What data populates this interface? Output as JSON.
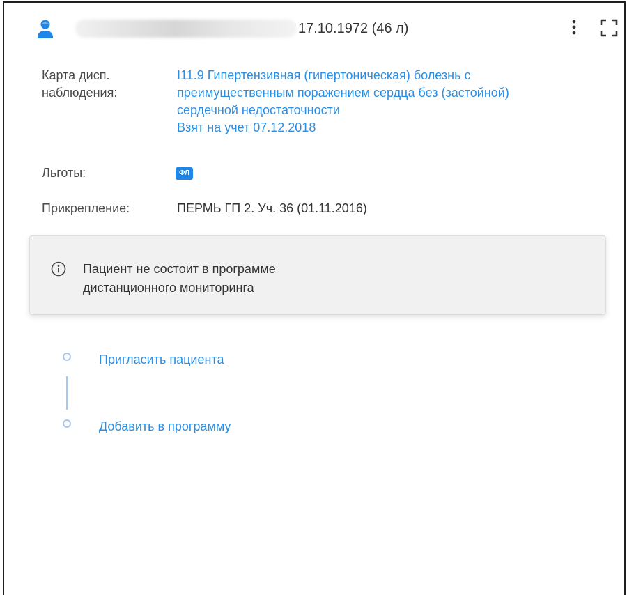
{
  "header": {
    "birth": "17.10.1972 (46 л)",
    "icons": {
      "avatar": "person-icon",
      "more": "more-vert-icon",
      "fullscreen": "fullscreen-icon"
    }
  },
  "disp": {
    "label_line1": "Карта дисп.",
    "label_line2": "наблюдения:",
    "diagnosis_line1": "I11.9 Гипертензивная (гипертоническая) болезнь с",
    "diagnosis_line2": "преимущественным поражением сердца без (застойной)",
    "diagnosis_line3": "сердечной недостаточности",
    "registered": "Взят на учет 07.12.2018"
  },
  "benefits": {
    "label": "Льготы:",
    "badge": "ФЛ"
  },
  "attachment": {
    "label": "Прикрепление:",
    "value": "ПЕРМЬ ГП 2. Уч. 36 (01.11.2016)"
  },
  "notice": {
    "icon": "info-icon",
    "line1": "Пациент не состоит в программе",
    "line2": "дистанционного мониторинга"
  },
  "steps": [
    {
      "label": "Пригласить пациента"
    },
    {
      "label": "Добавить в программу"
    }
  ],
  "colors": {
    "link": "#2c8ee2",
    "badge": "#1e86e6",
    "avatar": "#1e86e6",
    "step": "#a6c9ee"
  }
}
